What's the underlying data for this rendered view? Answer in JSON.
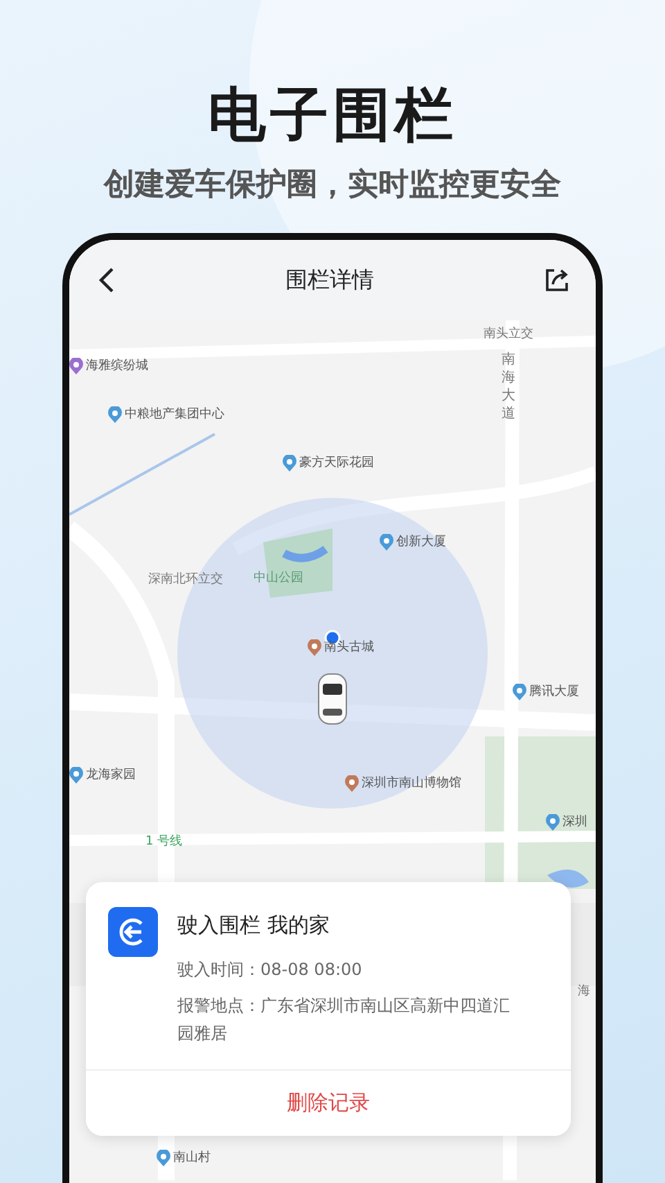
{
  "headline": "电子围栏",
  "subtitle": "创建爱车保护圈，实时监控更安全",
  "nav": {
    "title": "围栏详情"
  },
  "map_labels": [
    {
      "kind": "road",
      "text": "南头立交"
    },
    {
      "kind": "vroad",
      "text": "南海大道"
    },
    {
      "kind": "poi",
      "text": "海雅缤纷城",
      "color": "#9b6fd0"
    },
    {
      "kind": "poi",
      "text": "中粮地产集团中心",
      "color": "#4a9ad8"
    },
    {
      "kind": "poi",
      "text": "豪方天际花园",
      "color": "#4a9ad8"
    },
    {
      "kind": "poi",
      "text": "创新大厦",
      "color": "#4a9ad8"
    },
    {
      "kind": "road",
      "text": "深南北环立交"
    },
    {
      "kind": "park",
      "text": "中山公园"
    },
    {
      "kind": "poi",
      "text": "南头古城",
      "color": "#c07a5a"
    },
    {
      "kind": "poi",
      "text": "腾讯大厦",
      "color": "#4a9ad8"
    },
    {
      "kind": "poi",
      "text": "龙海家园",
      "color": "#4a9ad8"
    },
    {
      "kind": "poi",
      "text": "深圳市南山博物馆",
      "color": "#c07a5a"
    },
    {
      "kind": "poi",
      "text": "深圳",
      "color": "#4a9ad8"
    },
    {
      "kind": "metro",
      "text": "1 号线"
    },
    {
      "kind": "road",
      "text": "海"
    },
    {
      "kind": "poi",
      "text": "南山村",
      "color": "#4a9ad8"
    }
  ],
  "card": {
    "title": "驶入围栏 我的家",
    "time_label": "驶入时间：",
    "time": "08-08 08:00",
    "address_label": "报警地点：",
    "address": "广东省深圳市南山区高新中四道汇园雅居",
    "action": "删除记录"
  }
}
